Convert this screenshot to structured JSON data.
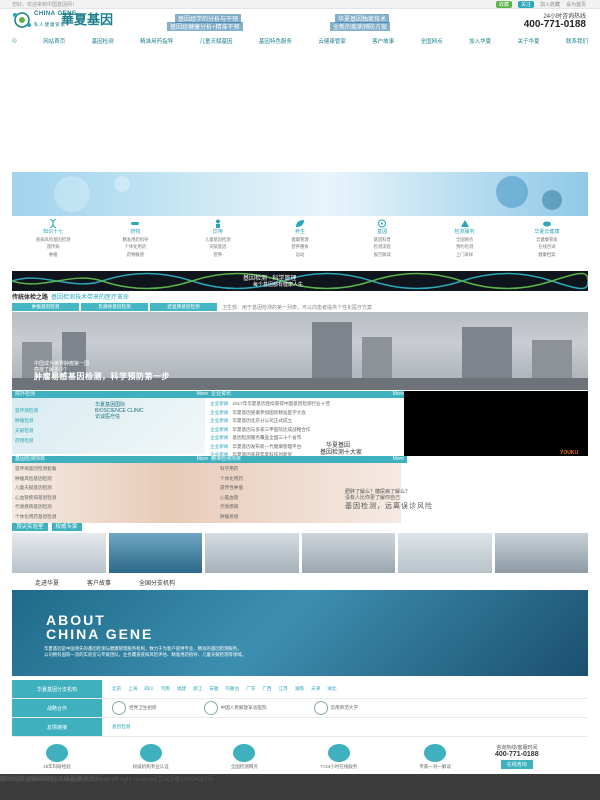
{
  "topbar": {
    "left": "您好，欢迎来到中国基因网！",
    "pill1": "收藏",
    "pill2": "关注",
    "link1": "加入收藏",
    "link2": "设为首页"
  },
  "logo": {
    "en": "CHINA GENE",
    "cn": "華夏基因",
    "sub": "私人健康管家"
  },
  "hotline": {
    "label": "24小时咨询热线",
    "number": "400-771-0188"
  },
  "nav": [
    "网站首页",
    "基因检测",
    "精准用药指导",
    "儿童天赋基因",
    "基因特色服务",
    "云健康管家",
    "客户故事",
    "全国网点",
    "加入华夏",
    "关于华夏",
    "联系我们"
  ],
  "banner": {
    "t1": "基因组学的分析与干预",
    "t2": "基因组健康分析+精准干预",
    "t3": "华夏基因独家技术",
    "t4": "全新的疾病预防方案"
  },
  "services": [
    {
      "title": "知识十七",
      "lines": [
        "疾病风险基因检测",
        "遗传病",
        "肿瘤"
      ],
      "icon": "dna-icon"
    },
    {
      "title": "药物",
      "lines": [
        "精准用药指导",
        "个体化用药",
        "药物敏感"
      ],
      "icon": "pill-icon"
    },
    {
      "title": "饮用",
      "lines": [
        "儿童基因检测",
        "天赋基因",
        "营养"
      ],
      "icon": "child-icon"
    },
    {
      "title": "养生",
      "lines": [
        "健康管理",
        "营养膳食",
        "运动"
      ],
      "icon": "leaf-icon"
    },
    {
      "title": "基因",
      "lines": [
        "基因科普",
        "检测流程",
        "报告解读"
      ],
      "icon": "gene-icon"
    },
    {
      "title": "检测服务",
      "lines": [
        "全国网点",
        "预约检测",
        "上门采样"
      ],
      "icon": "service-icon"
    },
    {
      "title": "华夏云健康",
      "lines": [
        "云健康管家",
        "在线咨询",
        "健康档案"
      ],
      "icon": "cloud-icon"
    }
  ],
  "dna_banner": {
    "t1": "基因检测 · 科学管理",
    "t2": "每个基因都有健康人生"
  },
  "section": {
    "title": "传统体检之路",
    "subtitle": "基因检测技术带来的医疗革命"
  },
  "tabs3": [
    "肿瘤基因检测",
    "乳腺癌基因检测",
    "结直肠基因检测"
  ],
  "news_line": "卫生部：用于基因检测的第一列表，可以向患者提供个性化医疗方案",
  "big_image": {
    "t1": "中国成为世界肿瘤第一国",
    "t2": "癌症了解多少？",
    "t3": "肿瘤易感基因检测，科学预防第一步"
  },
  "panels": {
    "p1": {
      "title": "院外检测",
      "more": "More"
    },
    "p2": {
      "title": "企业资讯",
      "more": "More"
    },
    "p3": {
      "title": "基因检测项目",
      "more": "More"
    },
    "p4": {
      "title": "精准检测项目",
      "more": "More"
    }
  },
  "clinic": {
    "t1": "华夏基因国际",
    "t2": "BIOSCIENCE CLINIC",
    "t3": "访谈医疗信",
    "items": [
      "遗传病检测",
      "肿瘤检测",
      "天赋检测",
      "药物检测"
    ]
  },
  "news": [
    {
      "tag": "企业新闻",
      "txt": "2017年华夏基因连续获得中国基因检测行业十佳"
    },
    {
      "tag": "企业新闻",
      "txt": "华夏基因受邀参加国际精准医学大会"
    },
    {
      "tag": "企业新闻",
      "txt": "华夏基因北京分公司正式成立"
    },
    {
      "tag": "企业新闻",
      "txt": "华夏基因与多家三甲医院达成战略合作"
    },
    {
      "tag": "企业新闻",
      "txt": "基因检测服务覆盖全国三十个省市"
    },
    {
      "tag": "企业新闻",
      "txt": "华夏基因发布新一代健康管理平台"
    },
    {
      "tag": "企业新闻",
      "txt": "华夏基因荣获年度科技创新奖"
    }
  ],
  "video": {
    "t1": "华夏基因",
    "t2": "基因检测十大家",
    "logo": "YOUKU"
  },
  "left_list": [
    "遗传病基因检测套餐",
    "肿瘤风险基因检测",
    "儿童天赋基因检测",
    "心血管疾病基因检测",
    "代谢疾病基因检测",
    "个体化用药基因检测"
  ],
  "mid_list": [
    "科学用药",
    "个体化用药",
    "遗传性肿瘤",
    "心脑血管",
    "代谢疾病",
    "肿瘤易感"
  ],
  "ad": {
    "l1": "肥胖了解么？糖尿病了解么？",
    "l2": "没有人比你更了解你自己",
    "l3": "基因检测，远离误诊风险"
  },
  "labs_tabs": [
    "顶尖实验室",
    "权威专家"
  ],
  "bottom_tabs": [
    "走进华夏",
    "客户故事",
    "全国分支机构"
  ],
  "about": {
    "en1": "ABOUT",
    "en2": "CHINA GENE",
    "p1": "华夏基因是中国领先的基因检测与健康管理服务机构，致力于为客户提供专业、精准的基因检测服务。",
    "p2": "公司拥有国际一流的实验室与专家团队，业务覆盖疾病风险评估、精准用药指导、儿童天赋检测等领域。"
  },
  "bars": {
    "row1": {
      "label": "华夏基因分支机构",
      "items": [
        "北京",
        "上海",
        "四川",
        "河南",
        "福建",
        "浙江",
        "安徽",
        "内蒙古",
        "广东",
        "广西",
        "江苏",
        "湖南",
        "天津",
        "湖北"
      ]
    },
    "row2": {
      "label": "战略合作",
      "partners": [
        "世界卫生组织",
        "中国人民解放军总医院",
        "云南师范大学"
      ]
    },
    "row3": {
      "label": "友情链接",
      "links": [
        "基因检测"
      ]
    }
  },
  "features": [
    {
      "label": "18年科研经验"
    },
    {
      "label": "权威机构专业认证"
    },
    {
      "label": "全国检测网点"
    },
    {
      "label": "7×24小时在线服务"
    },
    {
      "label": "专家一对一解读"
    }
  ],
  "contact": {
    "label": "咨询热线/客服时间",
    "number": "400-771-0188",
    "btn": "在线咨询"
  },
  "footer": {
    "links": [
      "基因检测",
      "全国网点",
      "加入华夏",
      "联系我们"
    ],
    "sub": "网站地图 | 隐私声明 | 法律条款",
    "copy": "©China Gene Health Management Group All right reserved 京ICP备16054097号"
  },
  "colors": {
    "accent": "#3fb0be",
    "brand": "#1b7f8c",
    "footer": "#3b3b3b"
  }
}
